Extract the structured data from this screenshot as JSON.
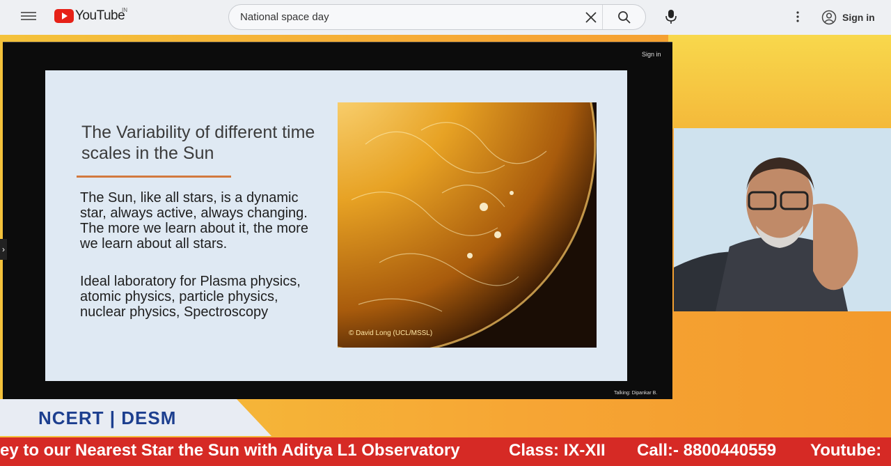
{
  "header": {
    "logo_text": "YouTube",
    "country_code": "IN",
    "search_value": "National space day",
    "signin_label": "Sign in"
  },
  "stream": {
    "tiny_signin": "Sign in",
    "talking": "Talking: Dipankar B."
  },
  "slide": {
    "title": "The Variability of different time scales in the  Sun",
    "paragraph1": "The Sun, like all stars, is a dynamic star, always active, always changing.  The more we learn about it, the more we learn about all stars.",
    "paragraph2": "Ideal laboratory for Plasma physics, atomic physics, particle physics, nuclear physics, Spectroscopy",
    "image_credit": "© David Long (UCL/MSSL)"
  },
  "branding": {
    "ncert": "NCERT  |  DESM"
  },
  "ticker": {
    "headline": "ey to our Nearest Star the Sun with Aditya L1 Observatory",
    "class": "Class: IX-XII",
    "call": "Call:- 8800440559",
    "youtube": "Youtube:"
  },
  "colors": {
    "ticker_bg": "#d62a25",
    "ncert_text": "#1d3f8f",
    "youtube_red": "#e62117"
  }
}
